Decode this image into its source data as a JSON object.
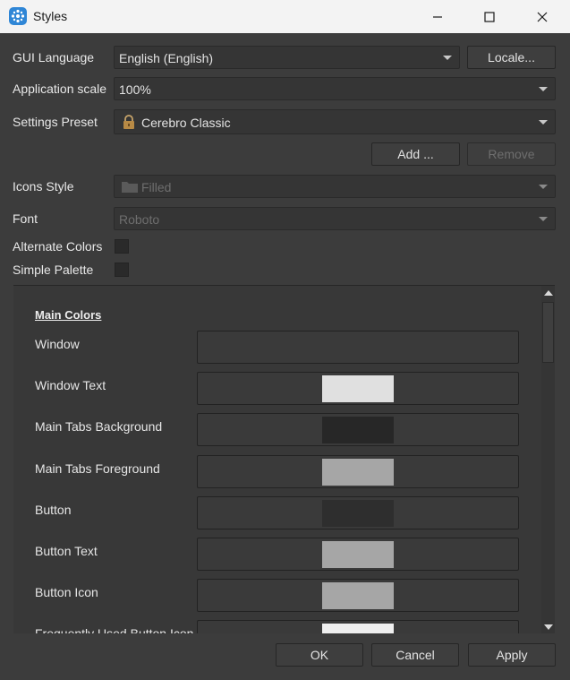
{
  "window": {
    "title": "Styles"
  },
  "settings": {
    "gui_language_label": "GUI Language",
    "gui_language_value": "English (English)",
    "locale_button": "Locale...",
    "app_scale_label": "Application scale",
    "app_scale_value": "100%",
    "settings_preset_label": "Settings Preset",
    "settings_preset_value": "Cerebro Classic",
    "add_button": "Add ...",
    "remove_button": "Remove",
    "icons_style_label": "Icons Style",
    "icons_style_value": "Filled",
    "font_label": "Font",
    "font_value": "Roboto",
    "alternate_colors_label": "Alternate Colors",
    "simple_palette_label": "Simple Palette"
  },
  "colors": {
    "section_title": "Main Colors",
    "rows": [
      {
        "label": "Window",
        "swatch": "#3a3a3a"
      },
      {
        "label": "Window Text",
        "swatch": "#e0e0e0"
      },
      {
        "label": "Main Tabs Background",
        "swatch": "#272727"
      },
      {
        "label": "Main Tabs Foreground",
        "swatch": "#a6a6a6"
      },
      {
        "label": "Button",
        "swatch": "#2e2e2e"
      },
      {
        "label": "Button Text",
        "swatch": "#a6a6a6"
      },
      {
        "label": "Button Icon",
        "swatch": "#a6a6a6"
      },
      {
        "label": "Frequently Used Button Icon",
        "swatch": "#efefef"
      }
    ]
  },
  "footer": {
    "ok": "OK",
    "cancel": "Cancel",
    "apply": "Apply"
  },
  "theme": {
    "background": "#3c3c3c",
    "accent": "#2f86d6"
  }
}
